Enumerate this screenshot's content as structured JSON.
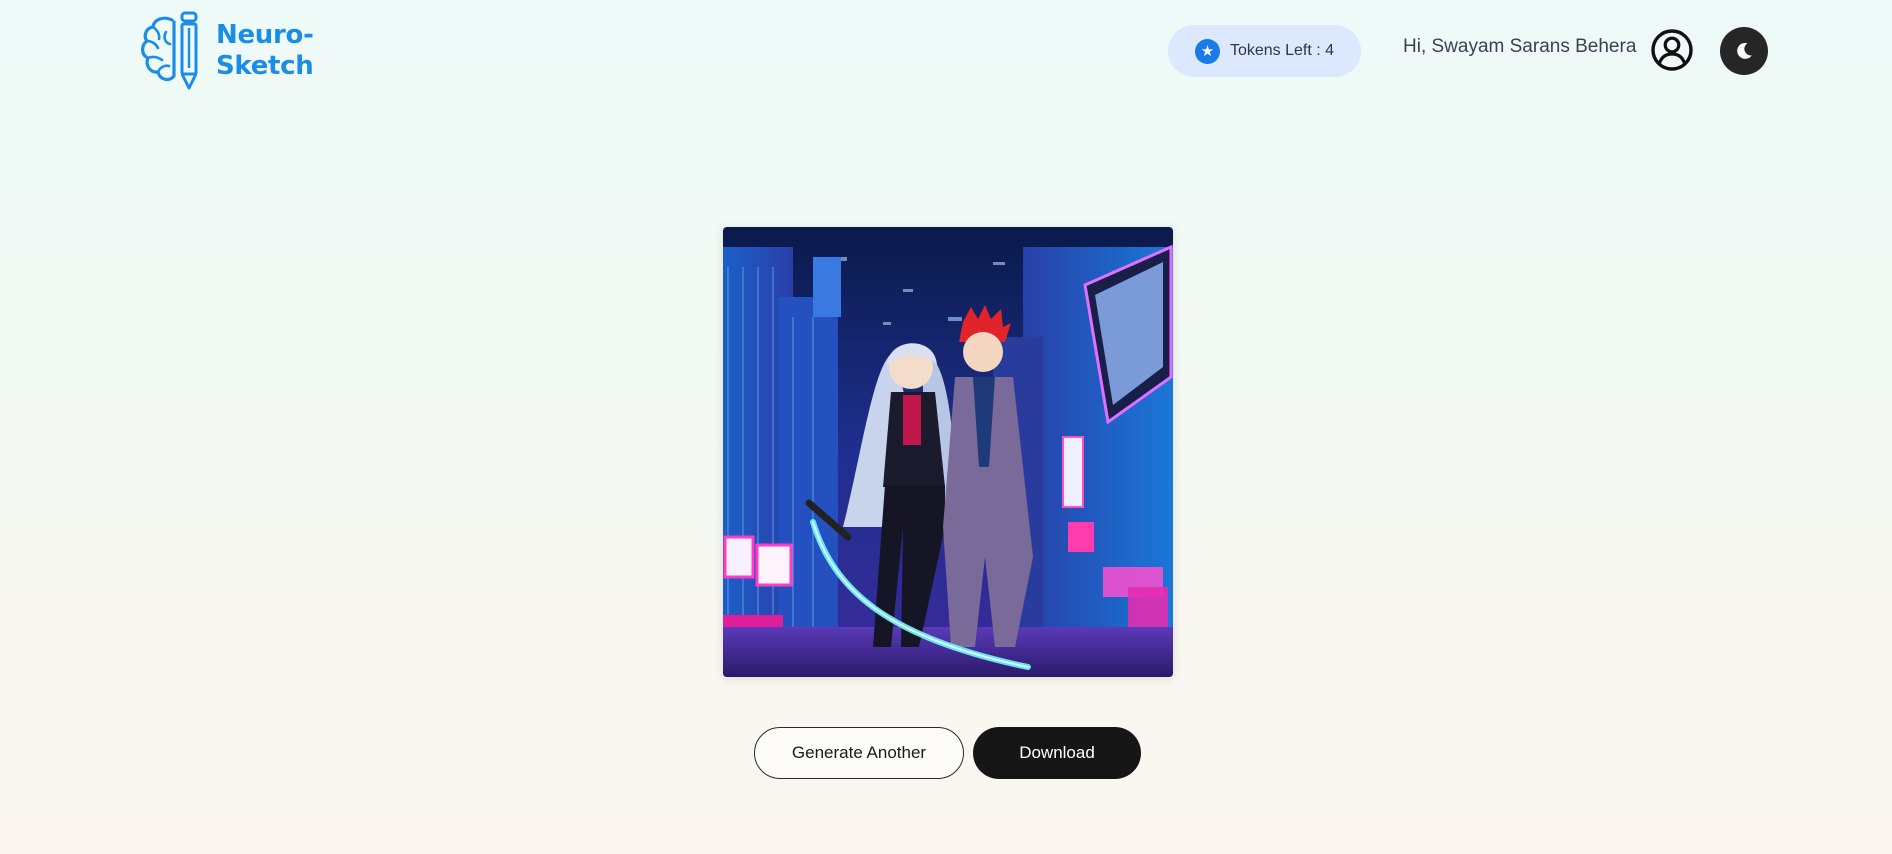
{
  "brand": {
    "line1": "Neuro-",
    "line2": "Sketch",
    "color": "#1b8de6"
  },
  "header": {
    "tokens_label": "Tokens Left : 4",
    "greeting": "Hi, Swayam Sarans Behera",
    "icons": {
      "tokens": "star-icon",
      "profile": "user-circle-icon",
      "theme": "moon-icon"
    }
  },
  "main": {
    "image_alt": "Generated anime artwork of two characters in a neon cyberpunk city",
    "buttons": {
      "generate_another": "Generate Another",
      "download": "Download"
    }
  },
  "colors": {
    "accent": "#1a7ae8",
    "tokens_pill_bg": "#dbe8fd",
    "dark_button": "#161616"
  }
}
